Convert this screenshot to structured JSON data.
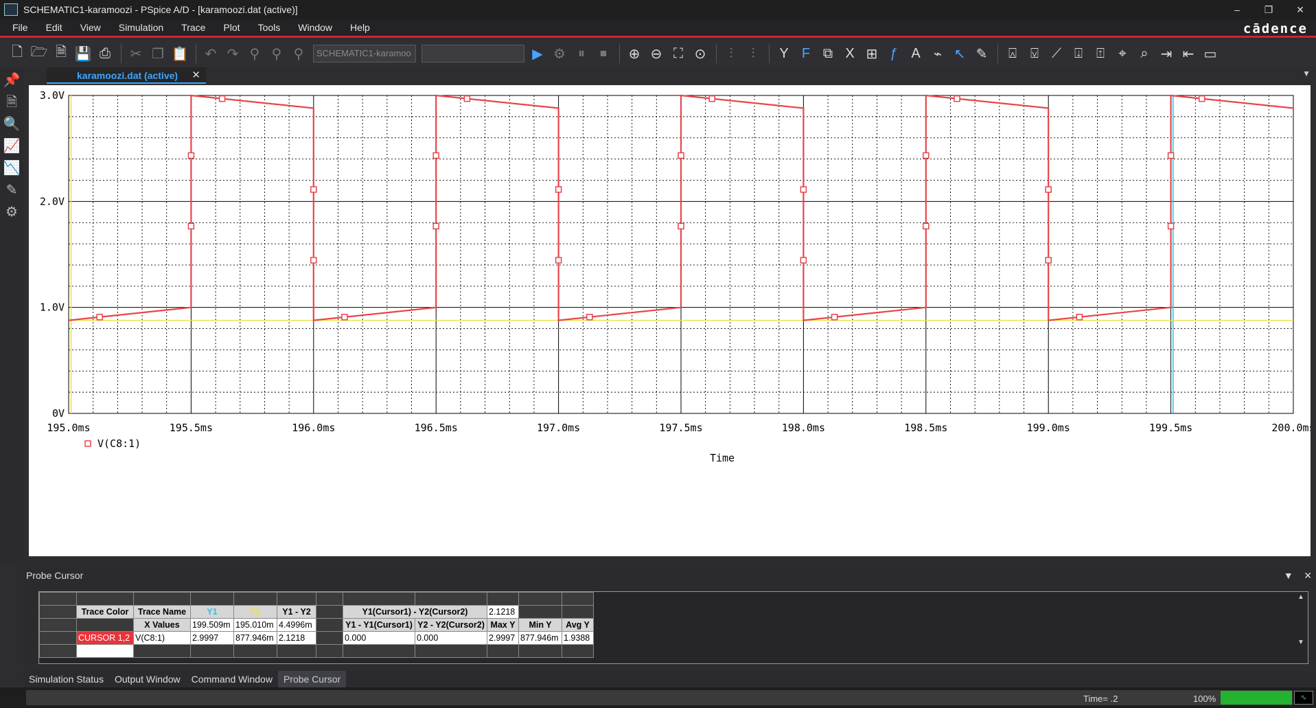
{
  "window": {
    "title": "SCHEMATIC1-karamoozi - PSpice A/D  - [karamoozi.dat (active)]",
    "minimize": "–",
    "restore": "❐",
    "close": "✕"
  },
  "menu": {
    "items": [
      "File",
      "Edit",
      "View",
      "Simulation",
      "Trace",
      "Plot",
      "Tools",
      "Window",
      "Help"
    ],
    "brand": "cādence"
  },
  "toolbar": {
    "profile_combo": "SCHEMATIC1-karamoo",
    "second_combo": ""
  },
  "document_tab": {
    "label": "karamoozi.dat (active)",
    "close": "✕"
  },
  "chart_data": {
    "type": "line",
    "xlabel": "Time",
    "x_ticks": [
      "195.0ms",
      "195.5ms",
      "196.0ms",
      "196.5ms",
      "197.0ms",
      "197.5ms",
      "198.0ms",
      "198.5ms",
      "199.0ms",
      "199.5ms",
      "200.0ms"
    ],
    "y_ticks": [
      "0V",
      "1.0V",
      "2.0V",
      "3.0V"
    ],
    "xlim": [
      195.0,
      200.0
    ],
    "ylim": [
      0,
      3.0
    ],
    "grid": true,
    "legend": "bottom-left",
    "series": [
      {
        "name": "V(C8:1)",
        "color": "#e8444a",
        "x": [
          195.0,
          195.5,
          195.5,
          196.0,
          196.0,
          196.5,
          196.5,
          197.0,
          197.0,
          197.5,
          197.5,
          198.0,
          198.0,
          198.5,
          198.5,
          199.0,
          199.0,
          199.5,
          199.5,
          200.0
        ],
        "y": [
          0.878,
          1.0,
          3.0,
          2.88,
          0.878,
          1.0,
          3.0,
          2.88,
          0.878,
          1.0,
          3.0,
          2.88,
          0.878,
          1.0,
          3.0,
          2.88,
          0.878,
          1.0,
          3.0,
          2.88
        ]
      }
    ],
    "cursors": [
      {
        "name": "Cursor 1",
        "x": 199.509,
        "color": "#2fc0e8"
      },
      {
        "name": "Cursor 2",
        "x": 195.01,
        "color": "#e8e43a",
        "y": 0.878
      }
    ]
  },
  "probe_cursor": {
    "panel_title": "Probe Cursor",
    "header_row": {
      "trace_color": "Trace Color",
      "trace_name": "Trace Name",
      "y1": "Y1",
      "y2": "Y2",
      "y1_minus_y2": "Y1 - Y2",
      "cursor_diff": "Y1(Cursor1) - Y2(Cursor2)",
      "cursor_diff_value": "2.1218"
    },
    "xvalues_row": {
      "label": "X Values",
      "y1": "199.509m",
      "y2": "195.010m",
      "diff": "4.4996m",
      "col_a": "Y1 - Y1(Cursor1)",
      "col_b": "Y2 - Y2(Cursor2)",
      "max": "Max Y",
      "min": "Min Y",
      "avg": "Avg Y"
    },
    "data_row": {
      "color_label": "CURSOR 1,2",
      "trace": "V(C8:1)",
      "y1": "2.9997",
      "y2": "877.946m",
      "diff": "2.1218",
      "a": "0.000",
      "b": "0.000",
      "max": "2.9997",
      "min": "877.946m",
      "avg": "1.9388"
    }
  },
  "bottom_tabs": [
    "Simulation Status",
    "Output Window",
    "Command Window",
    "Probe Cursor"
  ],
  "status": {
    "time": "Time= .2",
    "percent": "100%",
    "progress": 1.0
  }
}
